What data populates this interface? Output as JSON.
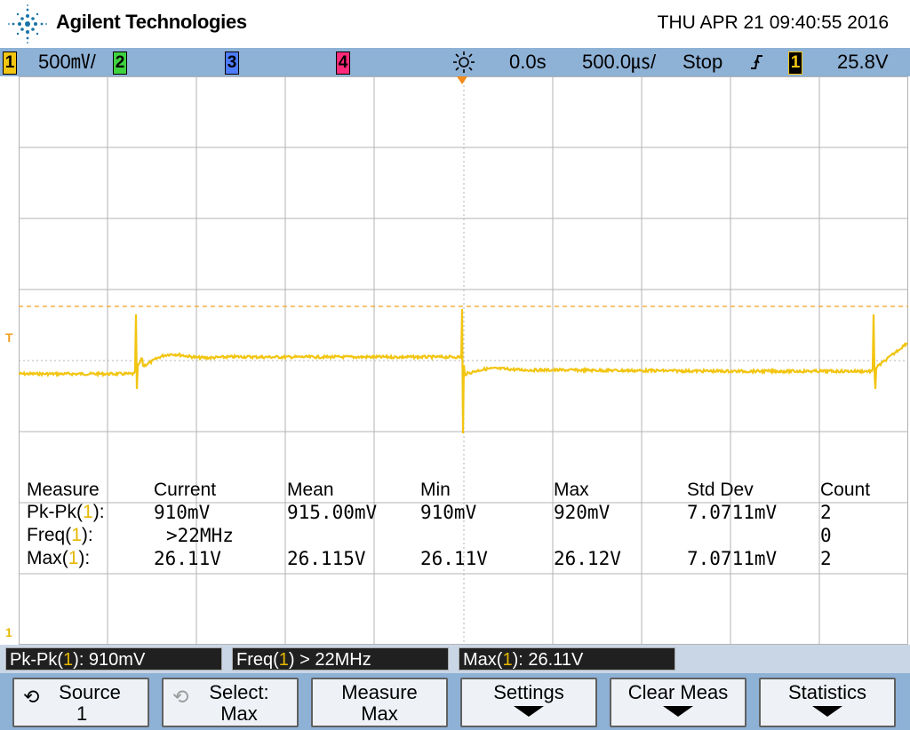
{
  "header": {
    "brand": "Agilent Technologies",
    "datetime": "THU APR 21 09:40:55 2016",
    "logo_icon": "agilent-spark-logo"
  },
  "statusbar": {
    "ch1_num": "1",
    "ch1_scale": "500㎷/",
    "ch2_num": "2",
    "ch3_num": "3",
    "ch4_num": "4",
    "delay": "0.0s",
    "timebase": "500.0㎲/",
    "run_state": "Stop",
    "trigger_slope_icon": "rising-edge-icon",
    "trigger_source": "1",
    "trigger_level": "25.8V",
    "colors": {
      "ch1": "#f2c511",
      "ch2": "#3fd23f",
      "ch3": "#4d7cff",
      "ch4": "#ff2a7a"
    }
  },
  "grid": {
    "trigger_marker": "T",
    "ground_marker": "1"
  },
  "measurements": {
    "headers": [
      "Measure",
      "Current",
      "Mean",
      "Min",
      "Max",
      "Std Dev",
      "Count"
    ],
    "rows": [
      {
        "name": "Pk-Pk",
        "ch": "1",
        "current": "910mV",
        "mean": "915.00mV",
        "min": "910mV",
        "max": "920mV",
        "stddev": "7.0711mV",
        "count": "2"
      },
      {
        "name": "Freq",
        "ch": "1",
        "current": ">22MHz",
        "mean": "",
        "min": "",
        "max": "",
        "stddev": "",
        "count": "0"
      },
      {
        "name": "Max",
        "ch": "1",
        "current": "26.11V",
        "mean": "26.115V",
        "min": "26.11V",
        "max": "26.12V",
        "stddev": "7.0711mV",
        "count": "2"
      }
    ]
  },
  "readouts": [
    {
      "name": "Pk-Pk",
      "ch": "1",
      "value": ": 910mV"
    },
    {
      "name": "Freq",
      "ch": "1",
      "value": " > 22MHz"
    },
    {
      "name": "Max",
      "ch": "1",
      "value": ": 26.11V"
    }
  ],
  "softkeys": [
    {
      "line1": "Source",
      "line2": "1",
      "icon": "rotate-knob-icon"
    },
    {
      "line1": "Select:",
      "line2": "Max",
      "icon": "rotate-knob-icon"
    },
    {
      "line1": "Measure",
      "line2": "Max"
    },
    {
      "line1": "Settings",
      "line2": "",
      "icon": "down-arrow-icon"
    },
    {
      "line1": "Clear Meas",
      "line2": "",
      "icon": "down-arrow-icon"
    },
    {
      "line1": "Statistics",
      "line2": "",
      "icon": "down-arrow-icon"
    }
  ]
}
